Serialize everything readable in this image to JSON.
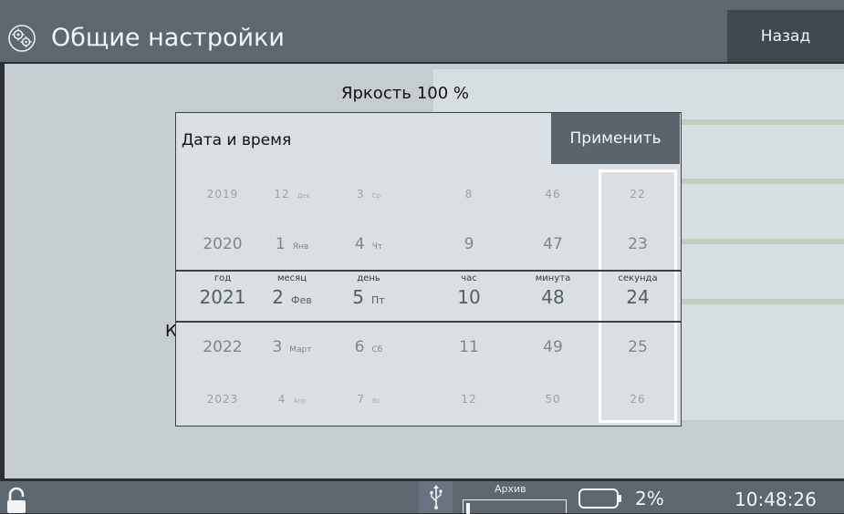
{
  "header": {
    "title": "Общие настройки",
    "back_label": "Назад",
    "icon": "gears-icon"
  },
  "settings": {
    "brightness_label": "Яркость",
    "brightness_value": "100 %",
    "partial_label": "К"
  },
  "datetime_dialog": {
    "title": "Дата и время",
    "apply_label": "Применить",
    "columns": [
      {
        "label": "год",
        "values": [
          {
            "n": "2019",
            "s": ""
          },
          {
            "n": "2020",
            "s": ""
          },
          {
            "n": "2021",
            "s": ""
          },
          {
            "n": "2022",
            "s": ""
          },
          {
            "n": "2023",
            "s": ""
          }
        ]
      },
      {
        "label": "месяц",
        "values": [
          {
            "n": "12",
            "s": "Дек"
          },
          {
            "n": "1",
            "s": "Янв"
          },
          {
            "n": "2",
            "s": "Фев"
          },
          {
            "n": "3",
            "s": "Март"
          },
          {
            "n": "4",
            "s": "Апр"
          }
        ]
      },
      {
        "label": "день",
        "values": [
          {
            "n": "3",
            "s": "Ср"
          },
          {
            "n": "4",
            "s": "Чт"
          },
          {
            "n": "5",
            "s": "Пт"
          },
          {
            "n": "6",
            "s": "Сб"
          },
          {
            "n": "7",
            "s": "Вс"
          }
        ]
      },
      {
        "label": "час",
        "values": [
          {
            "n": "8",
            "s": ""
          },
          {
            "n": "9",
            "s": ""
          },
          {
            "n": "10",
            "s": ""
          },
          {
            "n": "11",
            "s": ""
          },
          {
            "n": "12",
            "s": ""
          }
        ]
      },
      {
        "label": "минута",
        "values": [
          {
            "n": "46",
            "s": ""
          },
          {
            "n": "47",
            "s": ""
          },
          {
            "n": "48",
            "s": ""
          },
          {
            "n": "49",
            "s": ""
          },
          {
            "n": "50",
            "s": ""
          }
        ]
      },
      {
        "label": "секунда",
        "values": [
          {
            "n": "22",
            "s": ""
          },
          {
            "n": "23",
            "s": ""
          },
          {
            "n": "24",
            "s": ""
          },
          {
            "n": "25",
            "s": ""
          },
          {
            "n": "26",
            "s": ""
          }
        ]
      }
    ]
  },
  "status": {
    "archive_label": "Архив",
    "archive_fill": 0.04,
    "battery_pct": "2%",
    "time": "10:48:26",
    "lock_icon": "lock-open-icon",
    "usb_icon": "usb-icon",
    "battery_icon": "battery-icon"
  }
}
